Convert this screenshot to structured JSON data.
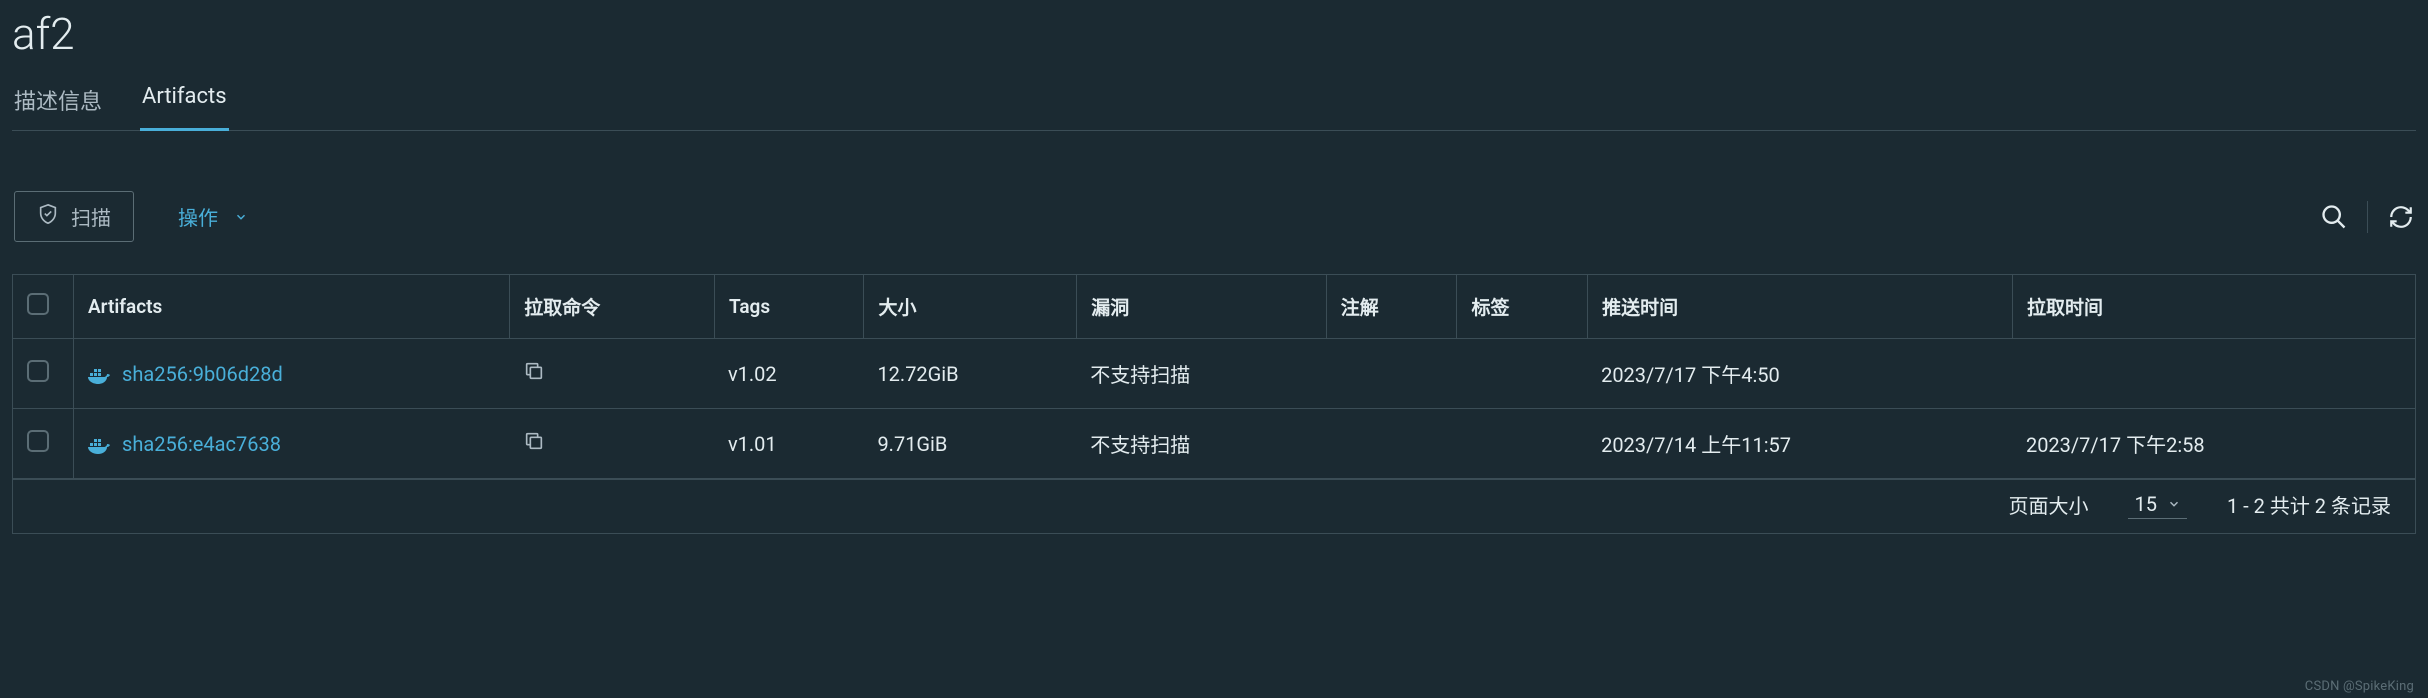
{
  "title": "af2",
  "tabs": {
    "desc": "描述信息",
    "artifacts": "Artifacts"
  },
  "toolbar": {
    "scan": "扫描",
    "ops": "操作"
  },
  "columns": {
    "artifacts": "Artifacts",
    "pull": "拉取命令",
    "tags": "Tags",
    "size": "大小",
    "vuln": "漏洞",
    "annot": "注解",
    "labels": "标签",
    "push": "推送时间",
    "pullTime": "拉取时间"
  },
  "rows": [
    {
      "artifact": "sha256:9b06d28d",
      "tag": "v1.02",
      "size": "12.72GiB",
      "vuln": "不支持扫描",
      "annot": "",
      "labels": "",
      "push": "2023/7/17 下午4:50",
      "pull": ""
    },
    {
      "artifact": "sha256:e4ac7638",
      "tag": "v1.01",
      "size": "9.71GiB",
      "vuln": "不支持扫描",
      "annot": "",
      "labels": "",
      "push": "2023/7/14 上午11:57",
      "pull": "2023/7/17 下午2:58"
    }
  ],
  "footer": {
    "pageSizeLabel": "页面大小",
    "pageSize": "15",
    "range": "1 - 2 共计 2 条记录"
  },
  "watermark": "CSDN @SpikeKing"
}
